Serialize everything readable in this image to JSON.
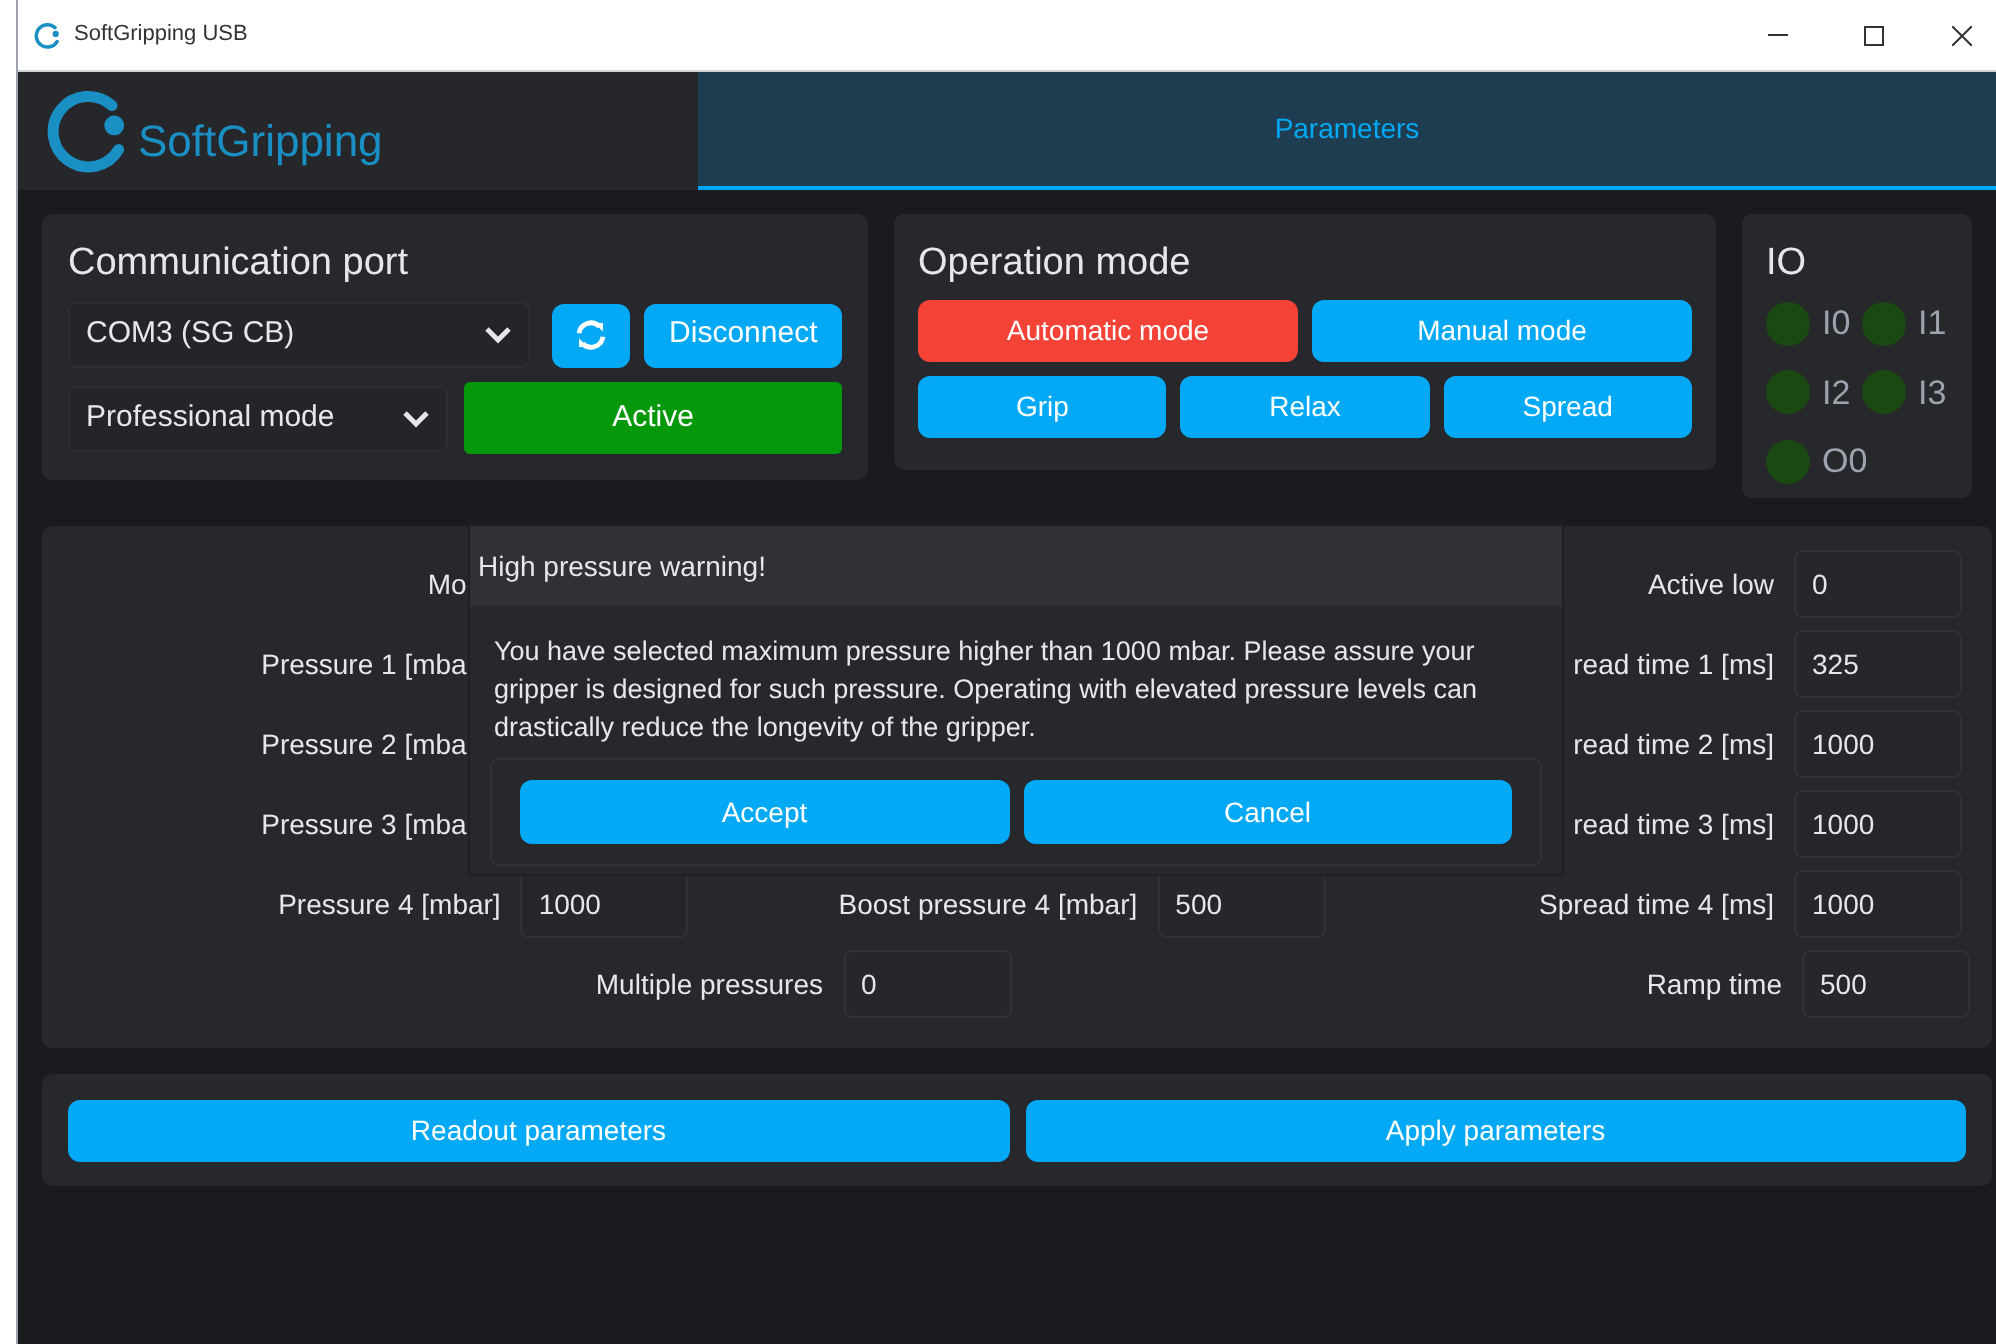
{
  "window": {
    "title": "SoftGripping USB"
  },
  "header": {
    "logo_text": "SoftGripping",
    "tabs": [
      {
        "label": "Parameters",
        "selected": true
      }
    ]
  },
  "communication_port": {
    "title": "Communication port",
    "port_select": {
      "value": "COM3 (SG CB)"
    },
    "disconnect_button": "Disconnect",
    "mode_select": {
      "value": "Professional mode"
    },
    "status_button": {
      "label": "Active",
      "active": true
    }
  },
  "operation_mode": {
    "title": "Operation mode",
    "modes": [
      {
        "label": "Automatic mode",
        "selected": true
      },
      {
        "label": "Manual mode",
        "selected": false
      }
    ],
    "actions": [
      "Grip",
      "Relax",
      "Spread"
    ]
  },
  "io": {
    "title": "IO",
    "channels": [
      {
        "label": "I0",
        "on": false
      },
      {
        "label": "I1",
        "on": false
      },
      {
        "label": "I2",
        "on": false
      },
      {
        "label": "I3",
        "on": false
      },
      {
        "label": "O0",
        "on": false
      }
    ]
  },
  "parameters": {
    "rows": [
      {
        "left": {
          "label": "Mo"
        },
        "right": {
          "label": "Active low",
          "value": "0"
        }
      },
      {
        "left": {
          "label": "Pressure 1 [mba"
        },
        "right": {
          "label": "read time 1 [ms]",
          "value": "325"
        }
      },
      {
        "left": {
          "label": "Pressure 2 [mba"
        },
        "right": {
          "label": "read time 2 [ms]",
          "value": "1000"
        }
      },
      {
        "left": {
          "label": "Pressure 3 [mba"
        },
        "right": {
          "label": "read time 3 [ms]",
          "value": "1000"
        }
      },
      {
        "left": {
          "label": "Pressure 4 [mbar]",
          "value": "1000"
        },
        "middle": {
          "label": "Boost pressure 4 [mbar]",
          "value": "500"
        },
        "right": {
          "label": "Spread time 4 [ms]",
          "value": "1000"
        }
      }
    ],
    "footer_fields": [
      {
        "label": "Multiple pressures",
        "value": "0"
      },
      {
        "label": "Ramp time",
        "value": "500"
      }
    ]
  },
  "bottom_buttons": [
    "Readout parameters",
    "Apply parameters"
  ],
  "dialog": {
    "title": "High pressure warning!",
    "message": "You have selected maximum pressure higher than 1000 mbar. Please assure your gripper is designed for such pressure. Operating with elevated pressure levels can drastically reduce the longevity of the gripper.",
    "buttons": [
      "Accept",
      "Cancel"
    ]
  }
}
